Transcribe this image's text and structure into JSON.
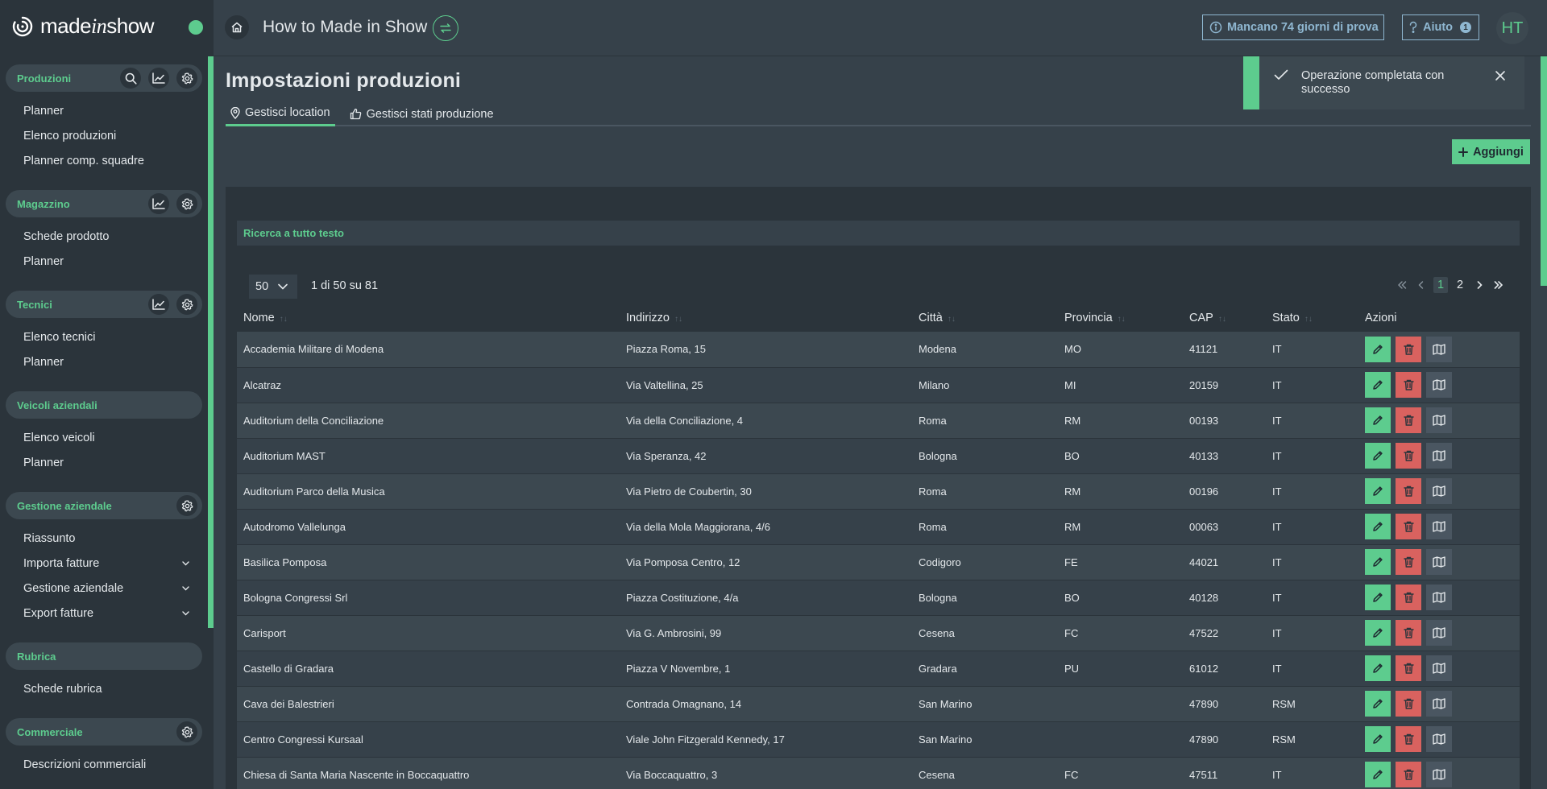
{
  "brand": {
    "logo_text_a": "made",
    "logo_text_b": "in",
    "logo_text_c": "show"
  },
  "topbar": {
    "app_title": "How to Made in Show",
    "trial_label": "Mancano 74 giorni di prova",
    "help_label": "Aiuto",
    "help_count": "1",
    "avatar_initials": "HT"
  },
  "sidebar": {
    "sections": [
      {
        "label": "Produzioni",
        "icons": [
          "search-icon",
          "chart-icon",
          "gear-icon"
        ],
        "items": [
          "Planner",
          "Elenco produzioni",
          "Planner comp. squadre"
        ]
      },
      {
        "label": "Magazzino",
        "icons": [
          "chart-icon",
          "gear-icon"
        ],
        "items": [
          "Schede prodotto",
          "Planner"
        ]
      },
      {
        "label": "Tecnici",
        "icons": [
          "chart-icon",
          "gear-icon"
        ],
        "items": [
          "Elenco tecnici",
          "Planner"
        ]
      },
      {
        "label": "Veicoli aziendali",
        "icons": [],
        "items": [
          "Elenco veicoli",
          "Planner"
        ]
      },
      {
        "label": "Gestione aziendale",
        "icons": [
          "gear-icon"
        ],
        "items": [
          "Riassunto",
          "Importa fatture",
          "Gestione aziendale",
          "Export fatture"
        ]
      },
      {
        "label": "Rubrica",
        "icons": [],
        "items": [
          "Schede rubrica"
        ]
      },
      {
        "label": "Commerciale",
        "icons": [
          "gear-icon"
        ],
        "items": [
          "Descrizioni commerciali"
        ]
      }
    ]
  },
  "page": {
    "title": "Impostazioni produzioni",
    "tabs": [
      {
        "label": "Gestisci location",
        "icon": "pin-icon"
      },
      {
        "label": "Gestisci stati produzione",
        "icon": "thumbs-up-icon"
      }
    ],
    "add_label": "Aggiungi",
    "search_label": "Ricerca a tutto testo",
    "per_page": "50",
    "count_label": "1 di 50 su 81",
    "pages": [
      "1",
      "2"
    ]
  },
  "toast": {
    "message": "Operazione completata con successo"
  },
  "table": {
    "columns": [
      "Nome",
      "Indirizzo",
      "Città",
      "Provincia",
      "CAP",
      "Stato",
      "Azioni"
    ],
    "rows": [
      [
        "Accademia Militare di Modena",
        "Piazza Roma, 15",
        "Modena",
        "MO",
        "41121",
        "IT"
      ],
      [
        "Alcatraz",
        "Via Valtellina, 25",
        "Milano",
        "MI",
        "20159",
        "IT"
      ],
      [
        "Auditorium della Conciliazione",
        "Via della Conciliazione, 4",
        "Roma",
        "RM",
        "00193",
        "IT"
      ],
      [
        "Auditorium MAST",
        "Via Speranza, 42",
        "Bologna",
        "BO",
        "40133",
        "IT"
      ],
      [
        "Auditorium Parco della Musica",
        "Via Pietro de Coubertin, 30",
        "Roma",
        "RM",
        "00196",
        "IT"
      ],
      [
        "Autodromo Vallelunga",
        "Via della Mola Maggiorana, 4/6",
        "Roma",
        "RM",
        "00063",
        "IT"
      ],
      [
        "Basilica Pomposa",
        "Via Pomposa Centro, 12",
        "Codigoro",
        "FE",
        "44021",
        "IT"
      ],
      [
        "Bologna Congressi Srl",
        "Piazza Costituzione, 4/a",
        "Bologna",
        "BO",
        "40128",
        "IT"
      ],
      [
        "Carisport",
        "Via G. Ambrosini, 99",
        "Cesena",
        "FC",
        "47522",
        "IT"
      ],
      [
        "Castello di Gradara",
        "Piazza V Novembre, 1",
        "Gradara",
        "PU",
        "61012",
        "IT"
      ],
      [
        "Cava dei Balestrieri",
        "Contrada Omagnano, 14",
        "San Marino",
        "",
        "47890",
        "RSM"
      ],
      [
        "Centro Congressi Kursaal",
        "Viale John Fitzgerald Kennedy, 17",
        "San Marino",
        "",
        "47890",
        "RSM"
      ],
      [
        "Chiesa di Santa Maria Nascente in Boccaquattro",
        "Via Boccaquattro, 3",
        "Cesena",
        "FC",
        "47511",
        "IT"
      ]
    ]
  },
  "colors": {
    "accent": "#5dcc8e",
    "danger": "#d9625f",
    "info": "#8fb7d1",
    "bg": "#36414a",
    "panel": "#2b343b"
  }
}
